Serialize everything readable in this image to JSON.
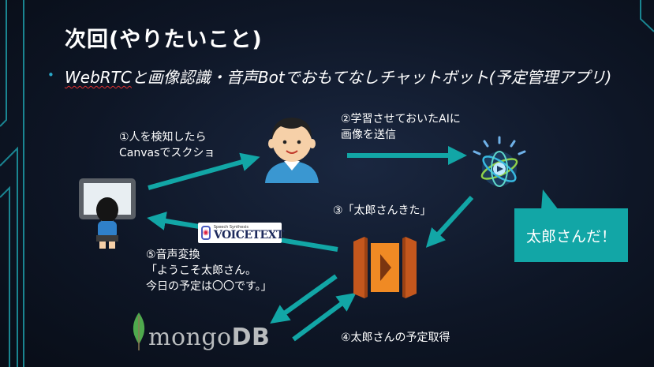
{
  "slide": {
    "title": "次回(やりたいこと)",
    "bullet": {
      "underlined": "WebRTC",
      "rest": "と画像認識・音声Botでおもてなしチャットボット(予定管理アプリ)"
    }
  },
  "steps": {
    "step1": {
      "line1": "①人を検知したら",
      "line2": "Canvasでスクショ"
    },
    "step2": {
      "line1": "②学習させておいたAIに",
      "line2": "画像を送信"
    },
    "step3": {
      "text": "③「太郎さんきた」"
    },
    "step4": {
      "text": "④太郎さんの予定取得"
    },
    "step5": {
      "line1": "⑤音声変換",
      "line2": "「ようこそ太郎さん。",
      "line3": "今日の予定は〇〇です。」"
    }
  },
  "callout": {
    "text": "太郎さんだ！"
  },
  "logos": {
    "voicetext": {
      "small": "Speech Synthesis",
      "main": "VOICETEXT"
    },
    "mongodb": {
      "mongo": "mongo",
      "db": "DB"
    }
  },
  "colors": {
    "accent": "#12a6a6",
    "background": "#0e1626",
    "bullet": "#29a9c9"
  },
  "icons": [
    "person-icon",
    "computer-user-icon",
    "watson-ai-icon",
    "aws-lambda-icon",
    "mongodb-leaf-icon",
    "voicetext-icon"
  ]
}
